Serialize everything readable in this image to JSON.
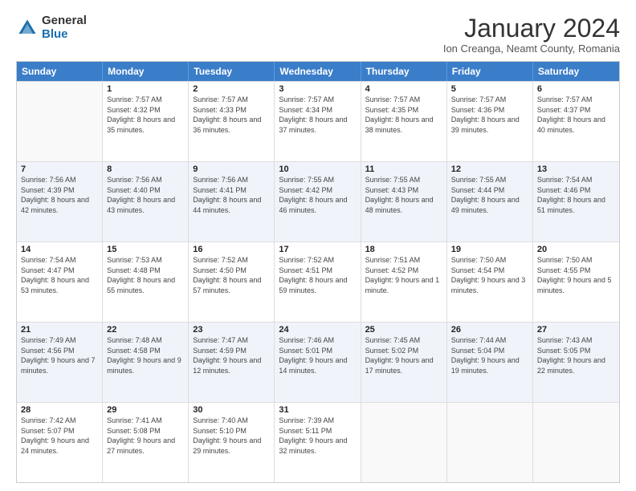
{
  "logo": {
    "general": "General",
    "blue": "Blue"
  },
  "title": "January 2024",
  "location": "Ion Creanga, Neamt County, Romania",
  "days_of_week": [
    "Sunday",
    "Monday",
    "Tuesday",
    "Wednesday",
    "Thursday",
    "Friday",
    "Saturday"
  ],
  "weeks": [
    [
      {
        "day": "",
        "sunrise": "",
        "sunset": "",
        "daylight": ""
      },
      {
        "day": "1",
        "sunrise": "Sunrise: 7:57 AM",
        "sunset": "Sunset: 4:32 PM",
        "daylight": "Daylight: 8 hours and 35 minutes."
      },
      {
        "day": "2",
        "sunrise": "Sunrise: 7:57 AM",
        "sunset": "Sunset: 4:33 PM",
        "daylight": "Daylight: 8 hours and 36 minutes."
      },
      {
        "day": "3",
        "sunrise": "Sunrise: 7:57 AM",
        "sunset": "Sunset: 4:34 PM",
        "daylight": "Daylight: 8 hours and 37 minutes."
      },
      {
        "day": "4",
        "sunrise": "Sunrise: 7:57 AM",
        "sunset": "Sunset: 4:35 PM",
        "daylight": "Daylight: 8 hours and 38 minutes."
      },
      {
        "day": "5",
        "sunrise": "Sunrise: 7:57 AM",
        "sunset": "Sunset: 4:36 PM",
        "daylight": "Daylight: 8 hours and 39 minutes."
      },
      {
        "day": "6",
        "sunrise": "Sunrise: 7:57 AM",
        "sunset": "Sunset: 4:37 PM",
        "daylight": "Daylight: 8 hours and 40 minutes."
      }
    ],
    [
      {
        "day": "7",
        "sunrise": "Sunrise: 7:56 AM",
        "sunset": "Sunset: 4:39 PM",
        "daylight": "Daylight: 8 hours and 42 minutes."
      },
      {
        "day": "8",
        "sunrise": "Sunrise: 7:56 AM",
        "sunset": "Sunset: 4:40 PM",
        "daylight": "Daylight: 8 hours and 43 minutes."
      },
      {
        "day": "9",
        "sunrise": "Sunrise: 7:56 AM",
        "sunset": "Sunset: 4:41 PM",
        "daylight": "Daylight: 8 hours and 44 minutes."
      },
      {
        "day": "10",
        "sunrise": "Sunrise: 7:55 AM",
        "sunset": "Sunset: 4:42 PM",
        "daylight": "Daylight: 8 hours and 46 minutes."
      },
      {
        "day": "11",
        "sunrise": "Sunrise: 7:55 AM",
        "sunset": "Sunset: 4:43 PM",
        "daylight": "Daylight: 8 hours and 48 minutes."
      },
      {
        "day": "12",
        "sunrise": "Sunrise: 7:55 AM",
        "sunset": "Sunset: 4:44 PM",
        "daylight": "Daylight: 8 hours and 49 minutes."
      },
      {
        "day": "13",
        "sunrise": "Sunrise: 7:54 AM",
        "sunset": "Sunset: 4:46 PM",
        "daylight": "Daylight: 8 hours and 51 minutes."
      }
    ],
    [
      {
        "day": "14",
        "sunrise": "Sunrise: 7:54 AM",
        "sunset": "Sunset: 4:47 PM",
        "daylight": "Daylight: 8 hours and 53 minutes."
      },
      {
        "day": "15",
        "sunrise": "Sunrise: 7:53 AM",
        "sunset": "Sunset: 4:48 PM",
        "daylight": "Daylight: 8 hours and 55 minutes."
      },
      {
        "day": "16",
        "sunrise": "Sunrise: 7:52 AM",
        "sunset": "Sunset: 4:50 PM",
        "daylight": "Daylight: 8 hours and 57 minutes."
      },
      {
        "day": "17",
        "sunrise": "Sunrise: 7:52 AM",
        "sunset": "Sunset: 4:51 PM",
        "daylight": "Daylight: 8 hours and 59 minutes."
      },
      {
        "day": "18",
        "sunrise": "Sunrise: 7:51 AM",
        "sunset": "Sunset: 4:52 PM",
        "daylight": "Daylight: 9 hours and 1 minute."
      },
      {
        "day": "19",
        "sunrise": "Sunrise: 7:50 AM",
        "sunset": "Sunset: 4:54 PM",
        "daylight": "Daylight: 9 hours and 3 minutes."
      },
      {
        "day": "20",
        "sunrise": "Sunrise: 7:50 AM",
        "sunset": "Sunset: 4:55 PM",
        "daylight": "Daylight: 9 hours and 5 minutes."
      }
    ],
    [
      {
        "day": "21",
        "sunrise": "Sunrise: 7:49 AM",
        "sunset": "Sunset: 4:56 PM",
        "daylight": "Daylight: 9 hours and 7 minutes."
      },
      {
        "day": "22",
        "sunrise": "Sunrise: 7:48 AM",
        "sunset": "Sunset: 4:58 PM",
        "daylight": "Daylight: 9 hours and 9 minutes."
      },
      {
        "day": "23",
        "sunrise": "Sunrise: 7:47 AM",
        "sunset": "Sunset: 4:59 PM",
        "daylight": "Daylight: 9 hours and 12 minutes."
      },
      {
        "day": "24",
        "sunrise": "Sunrise: 7:46 AM",
        "sunset": "Sunset: 5:01 PM",
        "daylight": "Daylight: 9 hours and 14 minutes."
      },
      {
        "day": "25",
        "sunrise": "Sunrise: 7:45 AM",
        "sunset": "Sunset: 5:02 PM",
        "daylight": "Daylight: 9 hours and 17 minutes."
      },
      {
        "day": "26",
        "sunrise": "Sunrise: 7:44 AM",
        "sunset": "Sunset: 5:04 PM",
        "daylight": "Daylight: 9 hours and 19 minutes."
      },
      {
        "day": "27",
        "sunrise": "Sunrise: 7:43 AM",
        "sunset": "Sunset: 5:05 PM",
        "daylight": "Daylight: 9 hours and 22 minutes."
      }
    ],
    [
      {
        "day": "28",
        "sunrise": "Sunrise: 7:42 AM",
        "sunset": "Sunset: 5:07 PM",
        "daylight": "Daylight: 9 hours and 24 minutes."
      },
      {
        "day": "29",
        "sunrise": "Sunrise: 7:41 AM",
        "sunset": "Sunset: 5:08 PM",
        "daylight": "Daylight: 9 hours and 27 minutes."
      },
      {
        "day": "30",
        "sunrise": "Sunrise: 7:40 AM",
        "sunset": "Sunset: 5:10 PM",
        "daylight": "Daylight: 9 hours and 29 minutes."
      },
      {
        "day": "31",
        "sunrise": "Sunrise: 7:39 AM",
        "sunset": "Sunset: 5:11 PM",
        "daylight": "Daylight: 9 hours and 32 minutes."
      },
      {
        "day": "",
        "sunrise": "",
        "sunset": "",
        "daylight": ""
      },
      {
        "day": "",
        "sunrise": "",
        "sunset": "",
        "daylight": ""
      },
      {
        "day": "",
        "sunrise": "",
        "sunset": "",
        "daylight": ""
      }
    ]
  ]
}
